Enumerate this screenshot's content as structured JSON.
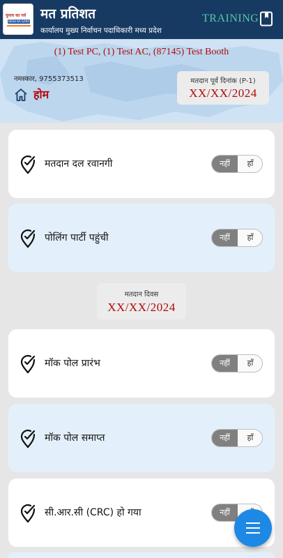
{
  "header": {
    "title": "मत प्रतिशत",
    "subtitle": "कार्यालय मुख्य निर्वाचन पदाधिकारी मध्य प्रदेश",
    "mode_label": "TRAINING",
    "logo": {
      "line1": "चुनाव का पर्व",
      "line2": "DESH KA GARV"
    }
  },
  "info": {
    "booth_line": "(1) Test PC, (1) Test AC, (87145) Test Booth",
    "greeting": "नमस्कार, 9755373513",
    "home_label": "होम",
    "pre_poll_label": "मतदान पूर्व दिनांक (P-1)",
    "pre_poll_date": "XX/XX/2024"
  },
  "poll_day": {
    "label": "मतदान दिवस",
    "date": "XX/XX/2024"
  },
  "items_before": [
    {
      "label": "मतदान दल रवानगी",
      "no": "नहीं",
      "yes": "हाँ",
      "selected": "no"
    },
    {
      "label": "पोलिंग पार्टी पहुंची",
      "no": "नहीं",
      "yes": "हाँ",
      "selected": "no"
    }
  ],
  "items_after": [
    {
      "label": "मॉक पोल प्रारंभ",
      "no": "नहीं",
      "yes": "हाँ",
      "selected": "no"
    },
    {
      "label": "मॉक पोल समाप्त",
      "no": "नहीं",
      "yes": "हाँ",
      "selected": "no"
    },
    {
      "label": "सी.आर.सी (CRC) हो गया",
      "no": "नहीं",
      "yes": "हाँ",
      "selected": "no"
    }
  ],
  "icons": {
    "book": "book-icon",
    "home": "home-icon",
    "pin": "pin-check-icon",
    "menu": "menu-icon"
  },
  "colors": {
    "header_bg": "#173a63",
    "accent_red": "#b00a0a",
    "training_green": "#55c9a8",
    "fab_blue": "#1e88e5"
  }
}
